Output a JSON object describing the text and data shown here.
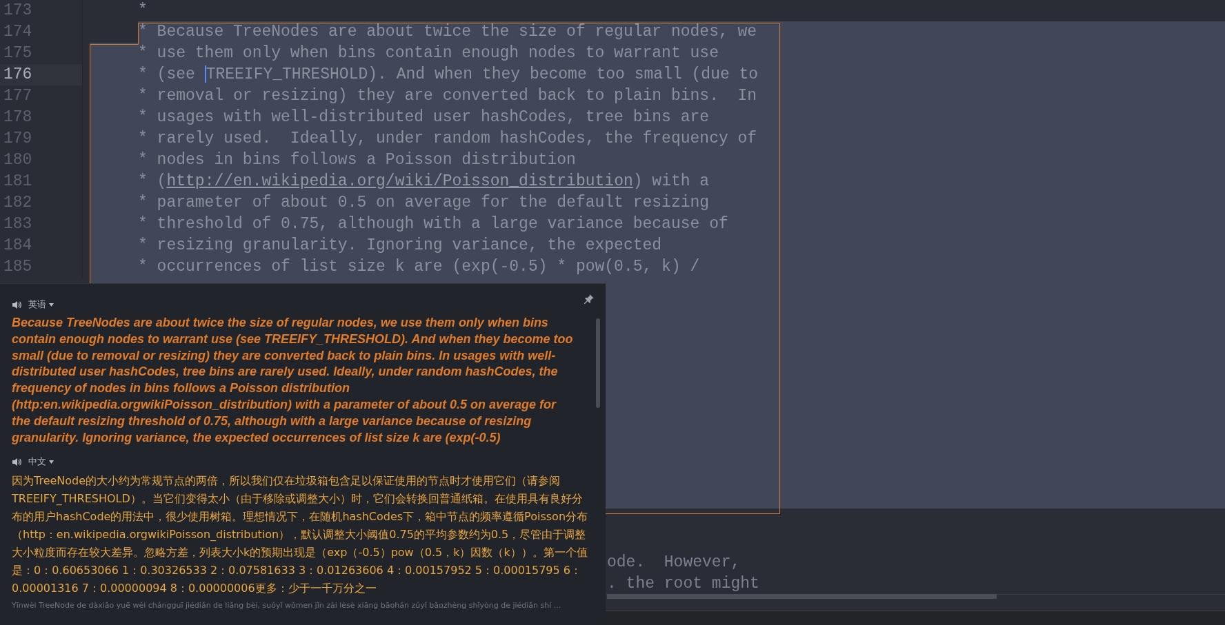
{
  "editor": {
    "lines": [
      {
        "number": "173",
        "current": false,
        "selected": false,
        "segments": [
          {
            "kind": "plain",
            "text": "*"
          }
        ]
      },
      {
        "number": "174",
        "current": false,
        "selected": true,
        "segments": [
          {
            "kind": "plain",
            "text": "* Because TreeNodes are about twice the size of regular nodes, we"
          }
        ]
      },
      {
        "number": "175",
        "current": false,
        "selected": true,
        "segments": [
          {
            "kind": "plain",
            "text": "* use them only when bins contain enough nodes to warrant use"
          }
        ]
      },
      {
        "number": "176",
        "current": true,
        "selected": true,
        "segments": [
          {
            "kind": "plain",
            "text": "* (see "
          },
          {
            "kind": "cursor"
          },
          {
            "kind": "plain",
            "text": "TREEIFY_THRESHOLD). And when they become too small (due to"
          }
        ]
      },
      {
        "number": "177",
        "current": false,
        "selected": true,
        "segments": [
          {
            "kind": "plain",
            "text": "* removal or resizing) they are converted back to plain bins.  In"
          }
        ]
      },
      {
        "number": "178",
        "current": false,
        "selected": true,
        "segments": [
          {
            "kind": "plain",
            "text": "* usages with well-distributed user hashCodes, tree bins are"
          }
        ]
      },
      {
        "number": "179",
        "current": false,
        "selected": true,
        "segments": [
          {
            "kind": "plain",
            "text": "* rarely used.  Ideally, under random hashCodes, the frequency of"
          }
        ]
      },
      {
        "number": "180",
        "current": false,
        "selected": true,
        "segments": [
          {
            "kind": "plain",
            "text": "* nodes in bins follows a Poisson distribution"
          }
        ]
      },
      {
        "number": "181",
        "current": false,
        "selected": true,
        "segments": [
          {
            "kind": "plain",
            "text": "* ("
          },
          {
            "kind": "link",
            "text": "http://en.wikipedia.org/wiki/Poisson_distribution"
          },
          {
            "kind": "plain",
            "text": ") with a"
          }
        ]
      },
      {
        "number": "182",
        "current": false,
        "selected": true,
        "segments": [
          {
            "kind": "plain",
            "text": "* parameter of about 0.5 on average for the default resizing"
          }
        ]
      },
      {
        "number": "183",
        "current": false,
        "selected": true,
        "segments": [
          {
            "kind": "plain",
            "text": "* threshold of 0.75, although with a large variance because of"
          }
        ]
      },
      {
        "number": "184",
        "current": false,
        "selected": true,
        "segments": [
          {
            "kind": "plain",
            "text": "* resizing granularity. Ignoring variance, the expected"
          }
        ]
      },
      {
        "number": "185",
        "current": false,
        "selected": true,
        "segments": [
          {
            "kind": "plain",
            "text": "* occurrences of list size k are (exp(-0.5) * pow(0.5, k) /"
          }
        ]
      }
    ],
    "partial_lines": [
      "ode.  However,",
      ". the root might"
    ]
  },
  "translation_popup": {
    "source": {
      "language": "英语",
      "text": "Because TreeNodes are about twice the size of regular nodes, we use them only when bins contain enough nodes to warrant use (see TREEIFY_THRESHOLD). And when they become too small (due to removal or resizing) they are converted back to plain bins. In usages with well-distributed user hashCodes, tree bins are rarely used. Ideally, under random hashCodes, the frequency of nodes in bins follows a Poisson distribution (http:en.wikipedia.orgwikiPoisson_distribution) with a parameter of about 0.5 on average for the default resizing threshold of 0.75, although with a large variance because of resizing granularity. Ignoring variance, the expected occurrences of list size k are (exp(-0.5)"
    },
    "target": {
      "language": "中文",
      "text": "因为TreeNode的大小约为常规节点的两倍，所以我们仅在垃圾箱包含足以保证使用的节点时才使用它们（请参阅TREEIFY_THRESHOLD）。当它们变得太小（由于移除或调整大小）时，它们会转换回普通纸箱。在使用具有良好分布的用户hashCode的用法中，很少使用树箱。理想情况下，在随机hashCodes下，箱中节点的频率遵循Poisson分布（http：en.wikipedia.orgwikiPoisson_distribution），默认调整大小阈值0.75的平均参数约为0.5，尽管由于调整大小粒度而存在较大差异。忽略方差，列表大小k的预期出现是（exp（-0.5）pow（0.5，k）因数（k））。第一个值是：0：0.60653066 1：0.30326533 2：0.07581633 3：0.01263606 4：0.00157952 5：0.00015795 6：0.00001316 7：0.00000094 8：0.00000006更多：少于一千万分之一",
      "romanization": "Yīnwèi TreeNode de dàxiǎo yuē wéi chángguī jiédiǎn de liǎng bèi, suǒyǐ wǒmen jǐn zài lèsè xiāng bāohán zúyǐ bǎozhèng shǐyòng de jiédiǎn shí ..."
    }
  }
}
